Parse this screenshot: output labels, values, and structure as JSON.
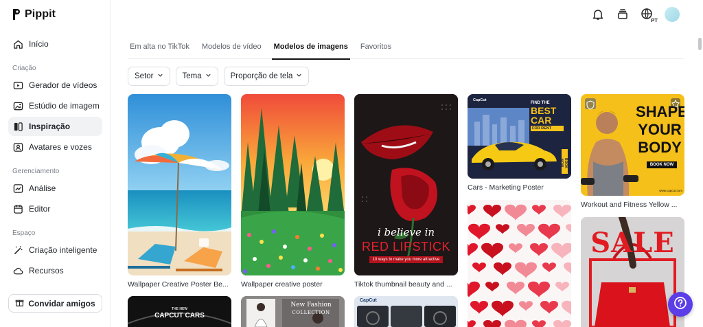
{
  "app": {
    "name": "Pippit"
  },
  "sidebar": {
    "home": "Início",
    "sections": [
      {
        "label": "Criação"
      },
      {
        "label": "Gerenciamento"
      },
      {
        "label": "Espaço"
      }
    ],
    "items": [
      {
        "label": "Gerador de vídeos",
        "icon": "video-plus-icon"
      },
      {
        "label": "Estúdio de imagem",
        "icon": "image-edit-icon"
      },
      {
        "label": "Inspiração",
        "icon": "inspiration-icon"
      },
      {
        "label": "Avatares e vozes",
        "icon": "avatar-icon"
      },
      {
        "label": "Análise",
        "icon": "chart-icon"
      },
      {
        "label": "Editor",
        "icon": "calendar-icon"
      },
      {
        "label": "Criação inteligente",
        "icon": "magic-wand-icon"
      },
      {
        "label": "Recursos",
        "icon": "cloud-icon"
      }
    ],
    "active_item": "Inspiração",
    "invite_label": "Convidar amigos"
  },
  "header": {
    "language_badge": "PT"
  },
  "tabs": [
    {
      "label": "Em alta no TikTok"
    },
    {
      "label": "Modelos de vídeo"
    },
    {
      "label": "Modelos de imagens"
    },
    {
      "label": "Favoritos"
    }
  ],
  "active_tab": "Modelos de imagens",
  "filters": [
    {
      "label": "Setor"
    },
    {
      "label": "Tema"
    },
    {
      "label": "Proporção de tela"
    }
  ],
  "cards": {
    "c1": {
      "caption": "Wallpaper Creative Poster Be..."
    },
    "c2": {
      "caption": "Wallpaper creative poster"
    },
    "c3": {
      "caption": "Tiktok thumbnail beauty and ...",
      "title_line1": "i believe in",
      "title_line2": "RED LIPSTICK",
      "subtitle": "10 ways to make you more attractive"
    },
    "c4": {
      "caption": "Cars - Marketing Poster",
      "brand": "CapCut",
      "line1": "FIND THE",
      "line2": "BEST",
      "line3": "CAR",
      "line4": "FOR RENT",
      "cta": "BOOK NOW"
    },
    "c5": {
      "caption": "Workout and Fitness Yellow ...",
      "line1": "SHAPE",
      "line2": "YOUR",
      "line3": "BODY",
      "cta": "BOOK NOW",
      "url": "www.capcut.com"
    },
    "c6": {
      "caption": ""
    },
    "c7": {
      "caption": "",
      "word": "SALE"
    },
    "c8": {
      "kicker": "THE NEW",
      "title": "CAPCUT CARS"
    },
    "c9": {
      "title_line1": "New Fashion",
      "title_line2": "COLLECTION"
    },
    "c10": {
      "brand": "CapCut"
    }
  },
  "colors": {
    "accent": "#5b3ee8",
    "yellow": "#f6c21b",
    "red": "#d61f2a"
  }
}
